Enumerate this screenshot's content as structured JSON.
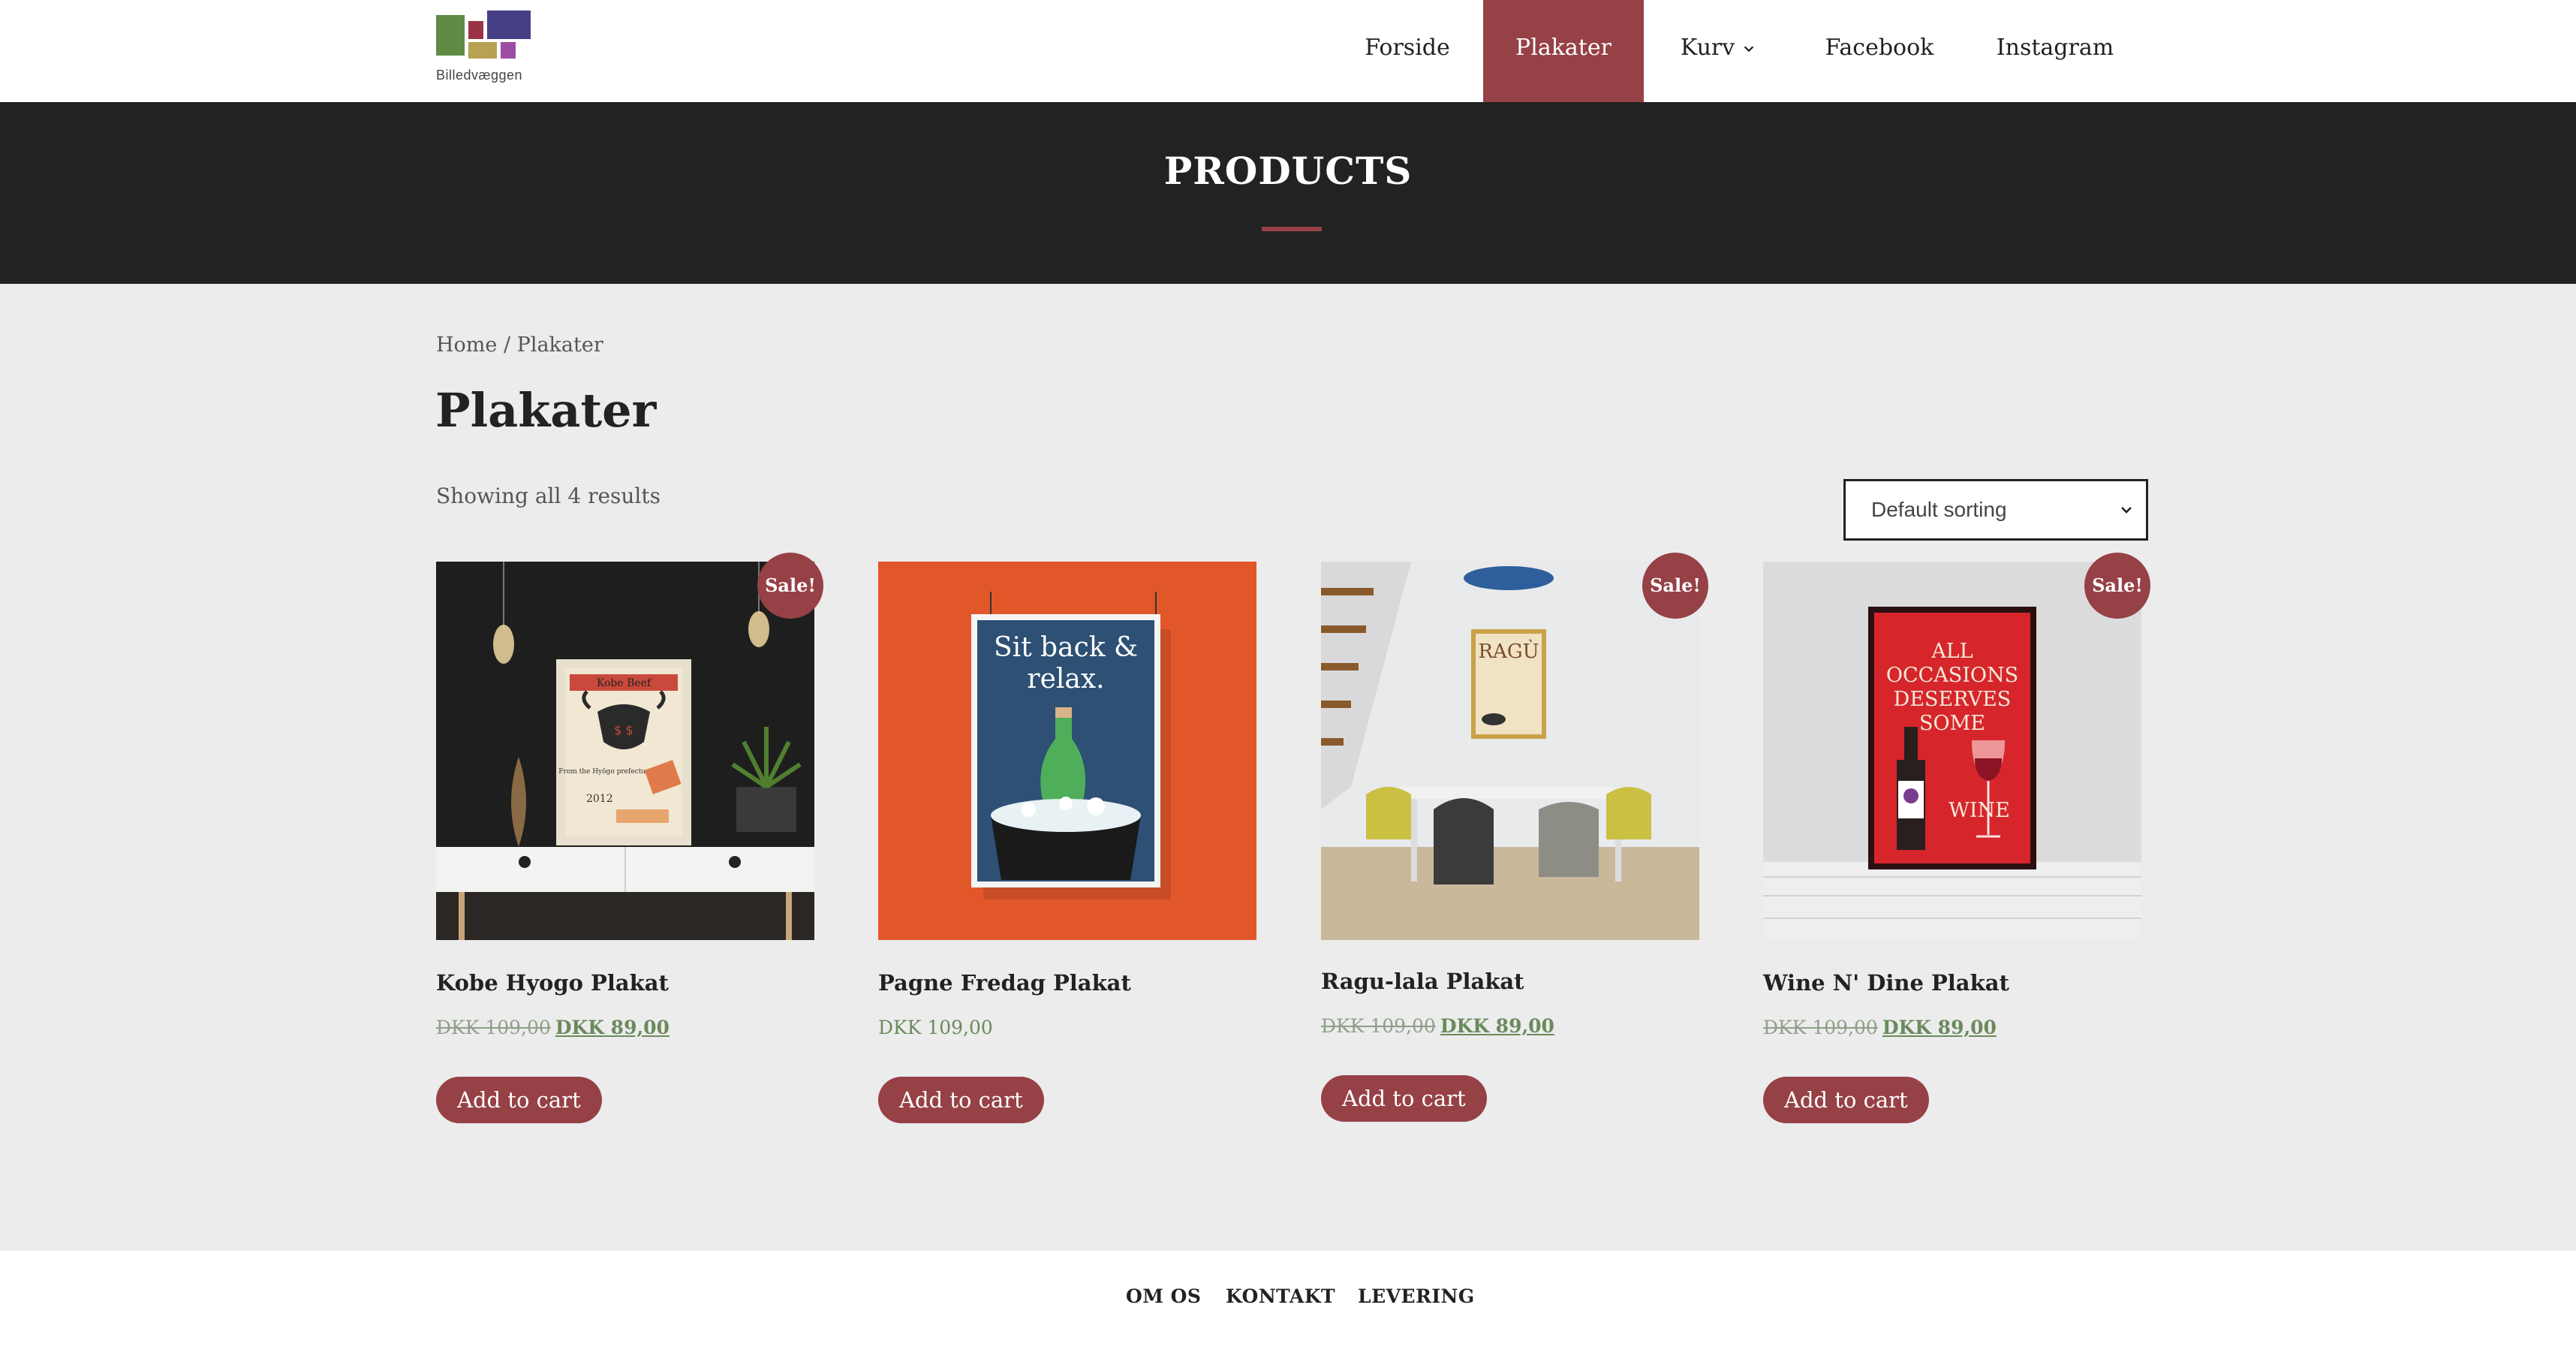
{
  "header": {
    "logo_text": "Billedvæggen",
    "nav": [
      {
        "label": "Forside",
        "active": false
      },
      {
        "label": "Plakater",
        "active": true
      },
      {
        "label": "Kurv",
        "active": false,
        "has_dropdown": true
      },
      {
        "label": "Facebook",
        "active": false
      },
      {
        "label": "Instagram",
        "active": false
      }
    ]
  },
  "banner": {
    "title": "PRODUCTS"
  },
  "breadcrumb": {
    "home": "Home",
    "separator": " / ",
    "current": "Plakater"
  },
  "page_title": "Plakater",
  "result_count": "Showing all 4 results",
  "sorting": {
    "selected": "Default sorting"
  },
  "colors": {
    "accent": "#954146",
    "banner_bg": "#222222",
    "page_bg": "#ececec",
    "price_green": "#6a8a5c"
  },
  "products": [
    {
      "name": "Kobe Hyogo Plakat",
      "sale": true,
      "sale_label": "Sale!",
      "old_price": "DKK 109,00",
      "price": "DKK 89,00",
      "button": "Add to cart",
      "poster": {
        "title": "Kobe Beef",
        "line1": "From the Hyōgo prefecture",
        "year": "2012"
      }
    },
    {
      "name": "Pagne Fredag Plakat",
      "sale": false,
      "price": "DKK 109,00",
      "button": "Add to cart",
      "poster": {
        "line1": "Sit back &",
        "line2": "relax."
      }
    },
    {
      "name": "Ragu-lala Plakat",
      "sale": true,
      "sale_label": "Sale!",
      "old_price": "DKK 109,00",
      "price": "DKK 89,00",
      "button": "Add to cart",
      "poster": {
        "title": "RAGÙ"
      }
    },
    {
      "name": "Wine N' Dine Plakat",
      "sale": true,
      "sale_label": "Sale!",
      "old_price": "DKK 109,00",
      "price": "DKK 89,00",
      "button": "Add to cart",
      "poster": {
        "line1": "ALL",
        "line2": "OCCASIONS",
        "line3": "DESERVES",
        "line4": "SOME",
        "line5": "WINE"
      }
    }
  ],
  "footer": {
    "links": [
      "OM OS",
      "KONTAKT",
      "LEVERING"
    ]
  }
}
